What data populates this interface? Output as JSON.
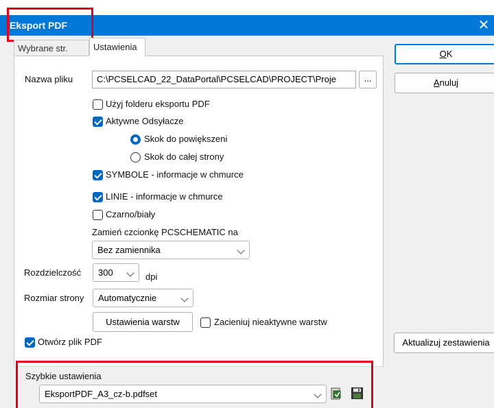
{
  "window": {
    "title": "Eksport PDF",
    "close_glyph": "✕"
  },
  "tabs": [
    {
      "label": "Wybrane str."
    },
    {
      "label": "Ustawienia"
    }
  ],
  "file": {
    "label": "Nazwa pliku",
    "value": "C:\\PCSELCAD_22_DataPortal\\PCSELCAD\\PROJECT\\Proje",
    "browse_label": "..."
  },
  "options": {
    "use_export_folder": {
      "label": "Użyj folderu eksportu PDF",
      "checked": false
    },
    "active_links": {
      "label": "Aktywne Odsyłacze",
      "checked": true
    },
    "jump_zoom": {
      "label": "Skok do powiększeni",
      "selected": true
    },
    "jump_page": {
      "label": "Skok do całej strony",
      "selected": false
    },
    "symbols_info": {
      "label": "SYMBOLE - informacje w chmurce",
      "checked": true
    },
    "lines_info": {
      "label": "LINIE - informacje w chmurce",
      "checked": true
    },
    "black_white": {
      "label": "Czarno/biały",
      "checked": false
    }
  },
  "font_replace": {
    "label": "Zamień czcionkę PCSCHEMATIC na",
    "value": "Bez zamiennika"
  },
  "resolution": {
    "label": "Rozdzielczość",
    "value": "300",
    "unit": "dpi"
  },
  "page_size": {
    "label": "Rozmiar strony",
    "value": "Automatycznie"
  },
  "layers": {
    "button_label": "Ustawienia warstw",
    "shade_label": "Zacieniuj nieaktywne warstw",
    "shade_checked": false
  },
  "open_pdf": {
    "label": "Otwórz plik PDF",
    "checked": true
  },
  "quick": {
    "label": "Szybkie ustawienia",
    "value": "EksportPDF_A3_cz-b.pdfset",
    "icons": [
      "apply-settings-icon",
      "save-disk-icon"
    ]
  },
  "buttons": {
    "ok": {
      "key": "O",
      "rest": "K"
    },
    "cancel": {
      "key": "A",
      "rest": "nuluj"
    },
    "update": {
      "label": "Aktualizuj zestawienia"
    }
  },
  "colors": {
    "titlebar": "#0078d7",
    "highlight": "#e0001b",
    "check": "#0067c0"
  }
}
